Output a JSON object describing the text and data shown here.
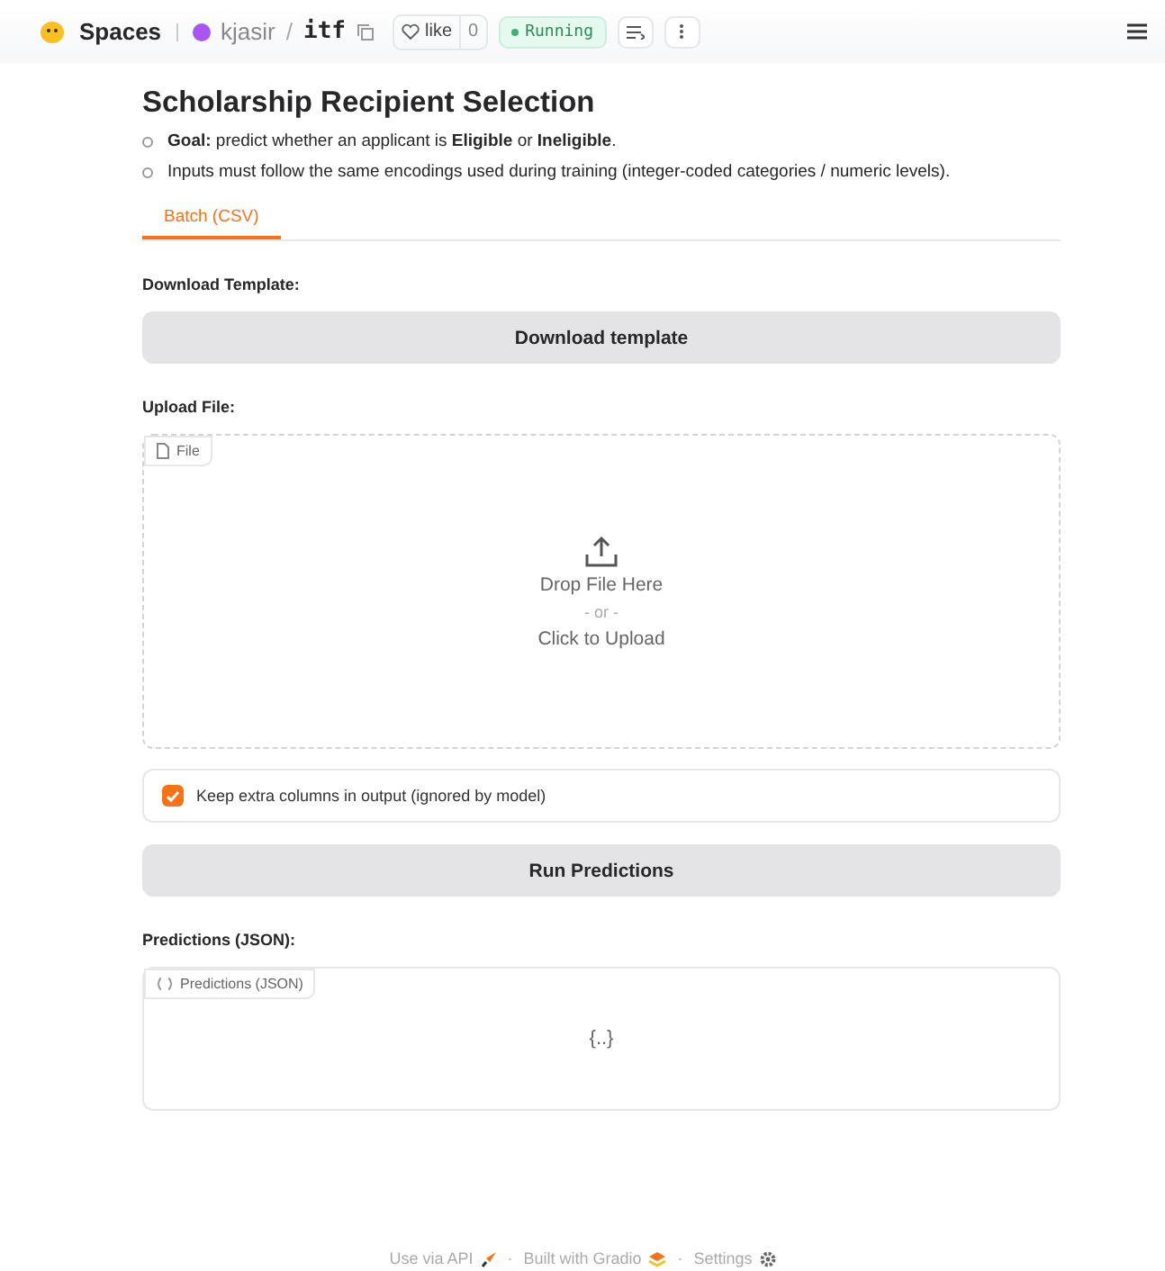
{
  "header": {
    "brand": "Spaces",
    "owner": "kjasir",
    "separator": "/",
    "repo": "itf",
    "like_label": "like",
    "like_count": "0",
    "status": "Running"
  },
  "title": "Scholarship Recipient Selection",
  "bullets": [
    "**Goal:** predict whether an applicant is **Eligible** or **Ineligible**.",
    "Inputs must follow the same encodings used during training (integer-coded categories / numeric levels)."
  ],
  "tabs": [
    {
      "label": "Batch (CSV)",
      "selected": true
    }
  ],
  "download": {
    "label": "Download Template:",
    "button": "Download template"
  },
  "upload": {
    "label": "Upload File:",
    "badge": "File",
    "drop_text": "Drop File Here",
    "or_text": "- or -",
    "click_text": "Click to Upload"
  },
  "checkbox": {
    "label": "Keep extra columns in output (ignored by model)",
    "checked": true
  },
  "run_button": "Run Predictions",
  "predictions": {
    "label": "Predictions (JSON):",
    "badge": "Predictions (JSON)",
    "empty_text": "{..}"
  },
  "footer": [
    {
      "text": "Use via API",
      "kind": "api"
    },
    {
      "text": "·",
      "kind": "dot"
    },
    {
      "text": "Built with Gradio",
      "kind": "gradio"
    },
    {
      "text": "·",
      "kind": "dot"
    },
    {
      "text": "Settings",
      "kind": "settings"
    }
  ]
}
